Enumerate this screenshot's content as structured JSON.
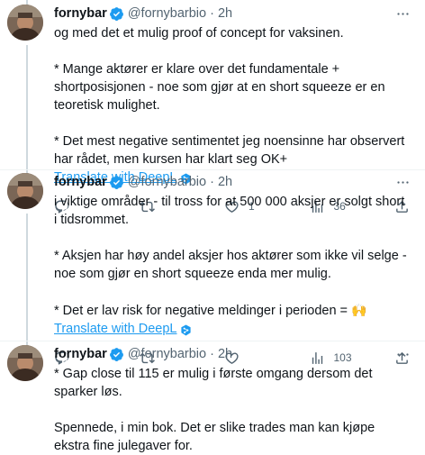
{
  "tweets": [
    {
      "name": "fornybar",
      "handle": "@fornybarbio",
      "dot": "·",
      "time": "2h",
      "paragraphs": [
        "og med det et mulig proof of concept for vaksinen.",
        "* Mange aktører er klare over det fundamentale + shortposisjonen - noe som gjør at en short squeeze er en teoretisk mulighet.",
        "* Det mest negative sentimentet jeg noensinne har observert har rådet, men kursen har klart seg OK+"
      ],
      "translate": "Translate with DeepL",
      "replies": "",
      "retweets": "",
      "likes": "1",
      "views": "36"
    },
    {
      "name": "fornybar",
      "handle": "@fornybarbio",
      "dot": "·",
      "time": "2h",
      "paragraphs": [
        "i viktige områder - til tross for at 500 000 aksjer er solgt short i tidsrommet.",
        "* Aksjen har høy andel aksjer hos aktører som ikke vil selge - noe som gjør en short squeeze enda mer mulig.",
        "* Det er lav risk for negative meldinger i perioden ="
      ],
      "emoji": "🙌",
      "translate": "Translate with DeepL",
      "replies": "",
      "retweets": "",
      "likes": "",
      "views": "103"
    },
    {
      "name": "fornybar",
      "handle": "@fornybarbio",
      "dot": "·",
      "time": "2h",
      "paragraphs": [
        "* Gap close til 115 er mulig i første omgang dersom det sparker løs.",
        "Spennede, i min bok. Det er slike trades man kan kjøpe ekstra fine julegaver for."
      ]
    }
  ],
  "colors": {
    "text": "#0f1419",
    "secondary": "#536471",
    "link": "#1d9bf0",
    "thread_line": "#cfd9de"
  },
  "icons": [
    "verified-badge-icon",
    "more-icon",
    "reply-icon",
    "retweet-icon",
    "like-icon",
    "views-icon",
    "share-icon",
    "deepl-icon"
  ]
}
